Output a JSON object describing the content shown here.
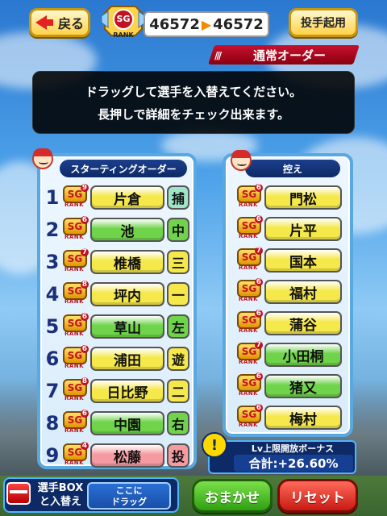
{
  "top_bar": {
    "back_label": "戻る",
    "rank_badge": "SG",
    "rank_word": "RANK",
    "score_from": "46572",
    "score_arrow": "▶",
    "score_to": "46572",
    "pitcher_button_label": "投手起用"
  },
  "section": {
    "title": "通常オーダー"
  },
  "instruction": {
    "line1": "ドラッグして選手を入替えてください。",
    "line2": "長押しで詳細をチェック出来ます。"
  },
  "starting_order": {
    "title": "スターティングオーダー",
    "players": [
      {
        "order": "1",
        "rank": "SG",
        "sub": "9",
        "name": "片倉",
        "position": "捕",
        "name_color": "#f5e84a",
        "pos_color": "#9fe6c8"
      },
      {
        "order": "2",
        "rank": "SG",
        "sub": "6",
        "name": "池",
        "position": "中",
        "name_color": "#6fd44a",
        "pos_color": "#6fd44a"
      },
      {
        "order": "3",
        "rank": "SG",
        "sub": "7",
        "name": "椎橋",
        "position": "三",
        "name_color": "#f5e84a",
        "pos_color": "#f5e84a"
      },
      {
        "order": "4",
        "rank": "SG",
        "sub": "8",
        "name": "坪内",
        "position": "一",
        "name_color": "#f5e84a",
        "pos_color": "#f5e84a"
      },
      {
        "order": "5",
        "rank": "SG",
        "sub": "6",
        "name": "草山",
        "position": "左",
        "name_color": "#6fd44a",
        "pos_color": "#6fd44a"
      },
      {
        "order": "6",
        "rank": "SG",
        "sub": "6",
        "name": "浦田",
        "position": "遊",
        "name_color": "#f5e84a",
        "pos_color": "#f5e84a"
      },
      {
        "order": "7",
        "rank": "SG",
        "sub": "8",
        "name": "日比野",
        "position": "二",
        "name_color": "#f5e84a",
        "pos_color": "#f5e84a"
      },
      {
        "order": "8",
        "rank": "SG",
        "sub": "6",
        "name": "中園",
        "position": "右",
        "name_color": "#6fd44a",
        "pos_color": "#6fd44a"
      },
      {
        "order": "9",
        "rank": "SG",
        "sub": "4",
        "name": "松藤",
        "position": "投",
        "name_color": "#f59aa0",
        "pos_color": "#f59aa0"
      }
    ]
  },
  "bench": {
    "title": "控え",
    "players": [
      {
        "rank": "SG",
        "sub": "6",
        "name": "門松",
        "name_color": "#f5e84a"
      },
      {
        "rank": "SG",
        "sub": "6",
        "name": "片平",
        "name_color": "#f5e84a"
      },
      {
        "rank": "SG",
        "sub": "7",
        "name": "国本",
        "name_color": "#f5e84a"
      },
      {
        "rank": "SG",
        "sub": "6",
        "name": "福村",
        "name_color": "#f5e84a"
      },
      {
        "rank": "SG",
        "sub": "6",
        "name": "蒲谷",
        "name_color": "#f5e84a"
      },
      {
        "rank": "SG",
        "sub": "7",
        "name": "小田桐",
        "name_color": "#6fd44a"
      },
      {
        "rank": "SG",
        "sub": "6",
        "name": "猪又",
        "name_color": "#6fd44a"
      },
      {
        "rank": "SG",
        "sub": "6",
        "name": "梅村",
        "name_color": "#f5e84a"
      }
    ]
  },
  "bonus": {
    "icon": "!",
    "title": "Lv上限開放ボーナス",
    "value": "合計:+26.60%"
  },
  "bottom": {
    "box_label_1": "選手BOX",
    "box_label_2": "と入替え",
    "drop_line_1": "ここに",
    "drop_line_2": "ドラッグ",
    "omakase_label": "おまかせ",
    "reset_label": "リセット"
  }
}
